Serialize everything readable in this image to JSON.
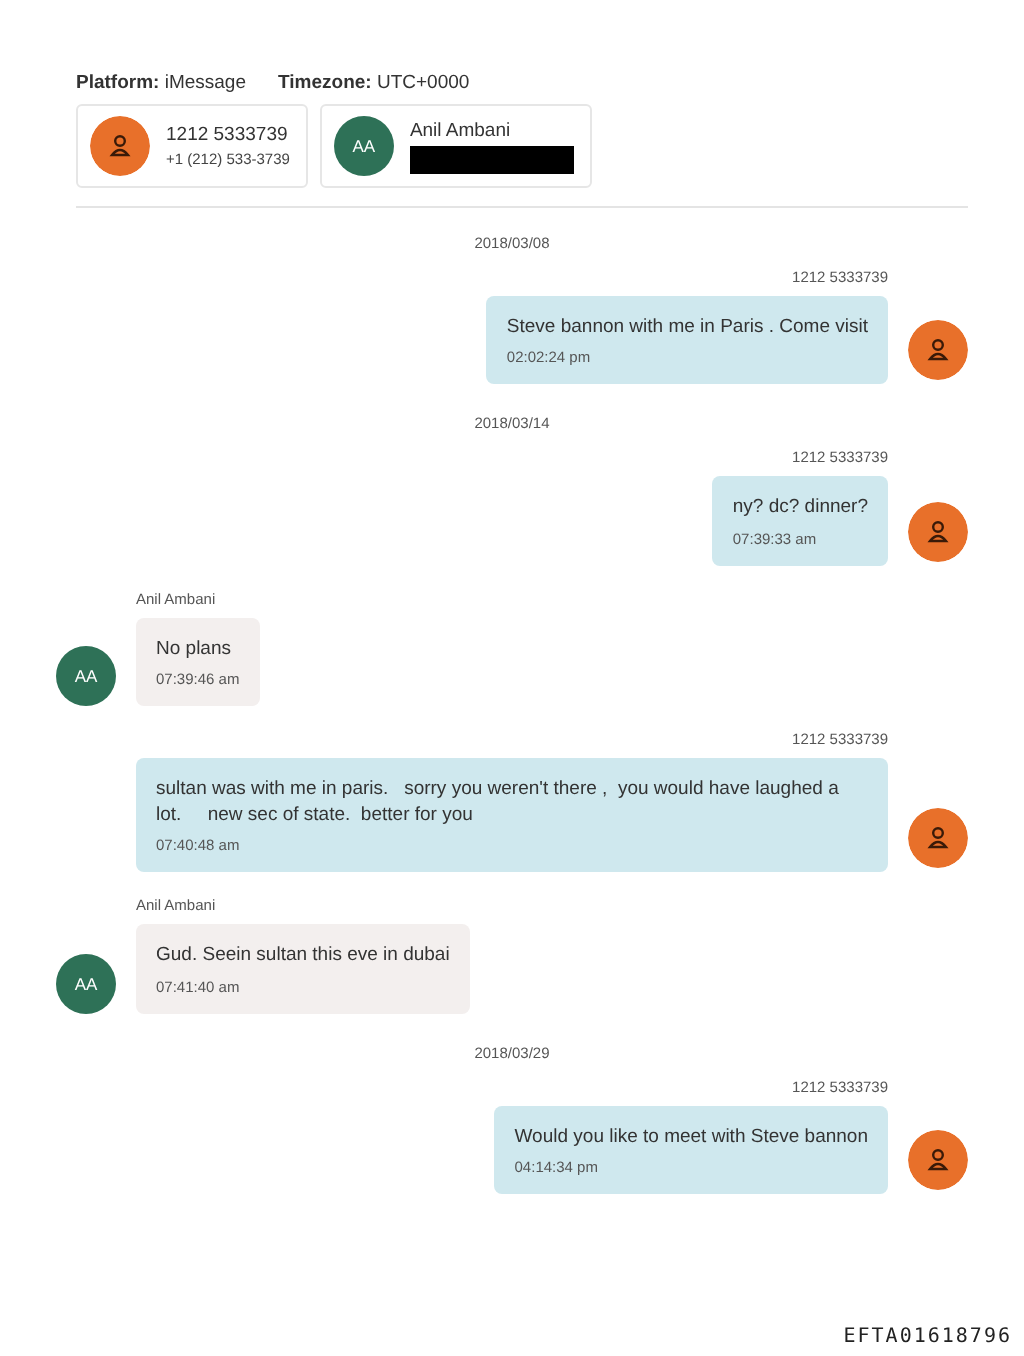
{
  "header": {
    "platform_label": "Platform:",
    "platform": "iMessage",
    "timezone_label": "Timezone:",
    "timezone": "UTC+0000"
  },
  "participants": [
    {
      "kind": "person",
      "name": "1212 5333739",
      "detail": "+1 (212) 533-3739"
    },
    {
      "kind": "initials",
      "initials": "AA",
      "name": "Anil Ambani",
      "redacted": true
    }
  ],
  "thread": [
    {
      "kind": "date",
      "text": "2018/03/08"
    },
    {
      "kind": "out",
      "sender": "1212 5333739",
      "text": "Steve bannon with me in Paris . Come visit",
      "time": "02:02:24 pm"
    },
    {
      "kind": "date",
      "text": "2018/03/14"
    },
    {
      "kind": "out",
      "sender": "1212 5333739",
      "text": "ny? dc? dinner?",
      "time": "07:39:33 am"
    },
    {
      "kind": "in",
      "sender": "Anil Ambani",
      "initials": "AA",
      "text": "No plans",
      "time": "07:39:46 am"
    },
    {
      "kind": "out",
      "sender": "1212 5333739",
      "text": "sultan was with me in paris.   sorry you weren't there ,  you would have laughed a lot.     new sec of state.  better for you",
      "time": "07:40:48 am"
    },
    {
      "kind": "in",
      "sender": "Anil Ambani",
      "initials": "AA",
      "text": "Gud. Seein sultan this eve in dubai",
      "time": "07:41:40 am"
    },
    {
      "kind": "date",
      "text": "2018/03/29"
    },
    {
      "kind": "out",
      "sender": "1212 5333739",
      "text": "Would you like to meet with Steve bannon",
      "time": "04:14:34 pm"
    }
  ],
  "stamp": "EFTA01618796"
}
